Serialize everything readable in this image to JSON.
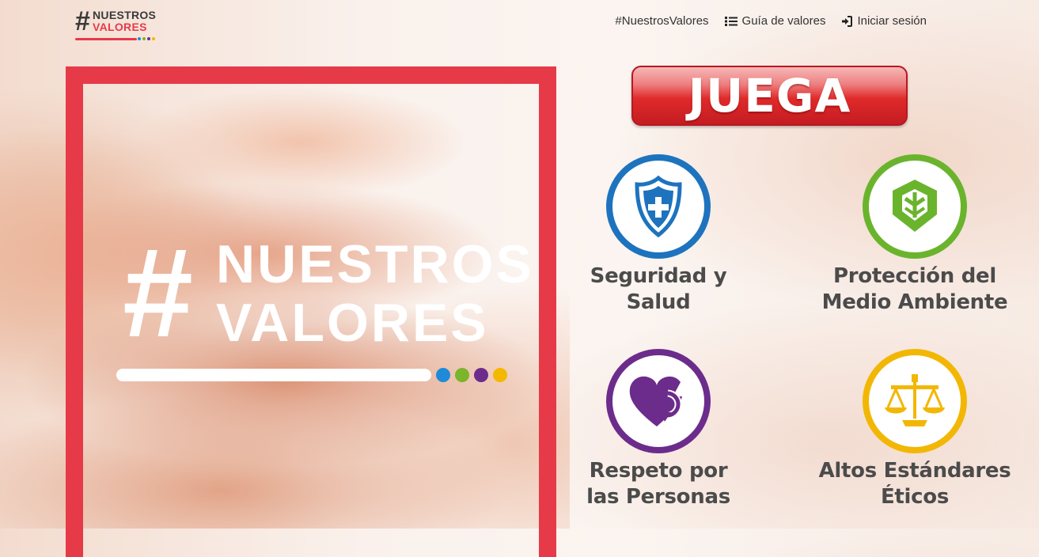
{
  "logo": {
    "hash": "#",
    "line1": "NUESTROS",
    "line2": "VALORES",
    "dot_colors": [
      "#1e8ad8",
      "#7ab52a",
      "#6c2c8c",
      "#f4b800"
    ]
  },
  "nav": {
    "items": [
      {
        "label": "#NuestrosValores",
        "icon": ""
      },
      {
        "label": "Guía de valores",
        "icon": "list-icon"
      },
      {
        "label": "Iniciar sesión",
        "icon": "sign-in-icon"
      }
    ]
  },
  "hero": {
    "hash": "#",
    "line1": "NUESTROS",
    "line2": "VALORES",
    "frame_color": "#e63a49",
    "dot_colors": [
      "#1e8ad8",
      "#7ab52a",
      "#6c2c8c",
      "#f4b800"
    ]
  },
  "play_button": {
    "label": "JUEGA",
    "color": "#e02a2a"
  },
  "values": [
    {
      "line1": "Seguridad y",
      "line2": "Salud",
      "icon": "shield-cross-icon",
      "color": "#1e73be"
    },
    {
      "line1": "Protección del",
      "line2": "Medio Ambiente",
      "icon": "leaf-icon",
      "color": "#6ab42d"
    },
    {
      "line1": "Respeto por",
      "line2": "las Personas",
      "icon": "heart-arrow-icon",
      "color": "#6c2c8c"
    },
    {
      "line1": "Altos Estándares",
      "line2": "Éticos",
      "icon": "scales-icon",
      "color": "#f2b705"
    }
  ]
}
